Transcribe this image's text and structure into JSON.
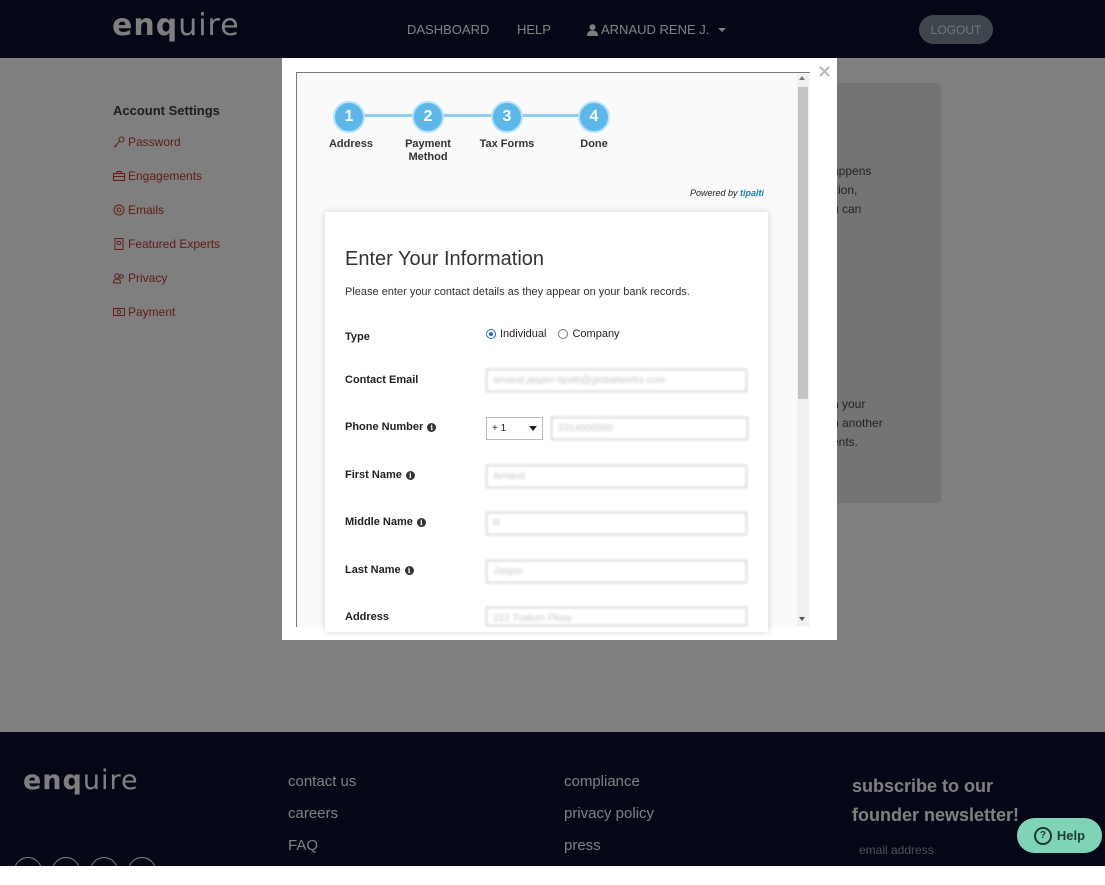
{
  "header": {
    "logo_bold": "enq",
    "logo_light": "uire",
    "nav": {
      "dashboard": "DASHBOARD",
      "help": "HELP",
      "user": "ARNAUD RENE J."
    },
    "logout": "LOGOUT"
  },
  "sidebar": {
    "title": "Account Settings",
    "items": [
      {
        "label": "Password",
        "icon": "key-icon"
      },
      {
        "label": "Engagements",
        "icon": "briefcase-icon"
      },
      {
        "label": "Emails",
        "icon": "at-icon"
      },
      {
        "label": "Featured Experts",
        "icon": "badge-icon"
      },
      {
        "label": "Privacy",
        "icon": "users-icon"
      },
      {
        "label": "Payment",
        "icon": "money-icon"
      }
    ]
  },
  "info_card": {
    "fragments_top": [
      "appens",
      "ition,",
      "u can"
    ],
    "fragments_bottom": [
      "n your",
      "h another",
      "ents."
    ]
  },
  "modal": {
    "steps": [
      {
        "number": "1",
        "label": "Address"
      },
      {
        "number": "2",
        "label": "Payment Method"
      },
      {
        "number": "3",
        "label": "Tax Forms"
      },
      {
        "number": "4",
        "label": "Done"
      }
    ],
    "powered_by": "Powered by",
    "powered_brand": "tipalti",
    "form": {
      "title": "Enter Your Information",
      "subtitle": "Please enter your contact details as they appear on your bank records.",
      "type_label": "Type",
      "type_options": [
        "Individual",
        "Company"
      ],
      "type_selected": "Individual",
      "email_label": "Contact Email",
      "email_value": "arnaud.jasper-tipalti@globalworks.com",
      "phone_label": "Phone Number",
      "phone_country_code": "+ 1",
      "phone_value": "3314000000",
      "first_name_label": "First Name",
      "first_name_value": "Arnaud",
      "middle_name_label": "Middle Name",
      "middle_name_value": "R",
      "last_name_label": "Last Name",
      "last_name_value": "Jasper",
      "address_label": "Address",
      "address_value": "222 Tualum Pkwy"
    }
  },
  "footer": {
    "logo_bold": "enq",
    "logo_light": "uire",
    "col1": [
      "contact us",
      "careers",
      "FAQ"
    ],
    "col2": [
      "compliance",
      "privacy policy",
      "press"
    ],
    "subscribe": "subscribe to our founder newsletter!",
    "email_placeholder": "email address",
    "help_button": "Help"
  },
  "colors": {
    "navy": "#0b0f2e",
    "step_blue": "#5bb8e8",
    "link_red": "#c0392b",
    "help_green": "#7fd4b8"
  }
}
